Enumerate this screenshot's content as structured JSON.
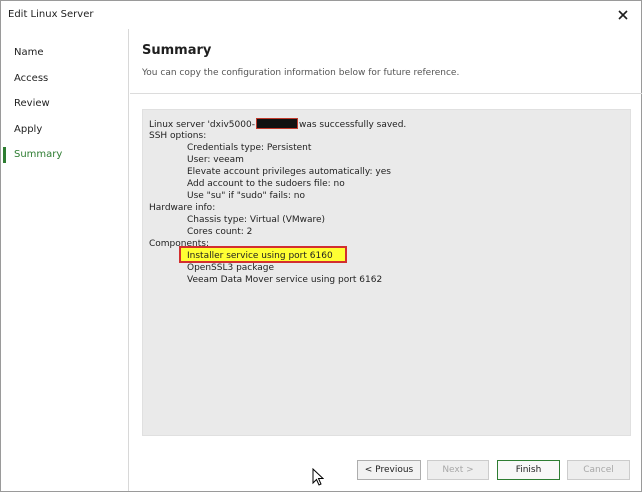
{
  "window": {
    "title": "Edit Linux Server",
    "close_glyph": "✕"
  },
  "sidebar": {
    "items": [
      {
        "label": "Name"
      },
      {
        "label": "Access"
      },
      {
        "label": "Review"
      },
      {
        "label": "Apply"
      },
      {
        "label": "Summary",
        "active": true
      }
    ]
  },
  "main": {
    "heading": "Summary",
    "description": "You can copy the configuration information below for future reference."
  },
  "summary": {
    "saved_prefix": "Linux server 'dxiv5000-",
    "saved_suffix": "was successfully saved.",
    "ssh_header": "SSH options:",
    "credentials": "Credentials type: Persistent",
    "user": "User: veeam",
    "elevate": "Elevate account privileges automatically: yes",
    "sudoers": "Add account to the sudoers file: no",
    "su": "Use \"su\" if \"sudo\" fails: no",
    "hardware_header": "Hardware info:",
    "chassis": "Chassis type: Virtual (VMware)",
    "cores": "Cores count: 2",
    "components_header": "Components:",
    "installer": "Installer service using port 6160",
    "openssl": "OpenSSL3 package",
    "datamover": "Veeam Data Mover service using port 6162"
  },
  "buttons": {
    "previous": "< Previous",
    "next": "Next >",
    "finish": "Finish",
    "cancel": "Cancel"
  },
  "colors": {
    "accent_green": "#2e7d32",
    "highlight_yellow": "#ffff33",
    "highlight_border": "#d32f2f"
  }
}
